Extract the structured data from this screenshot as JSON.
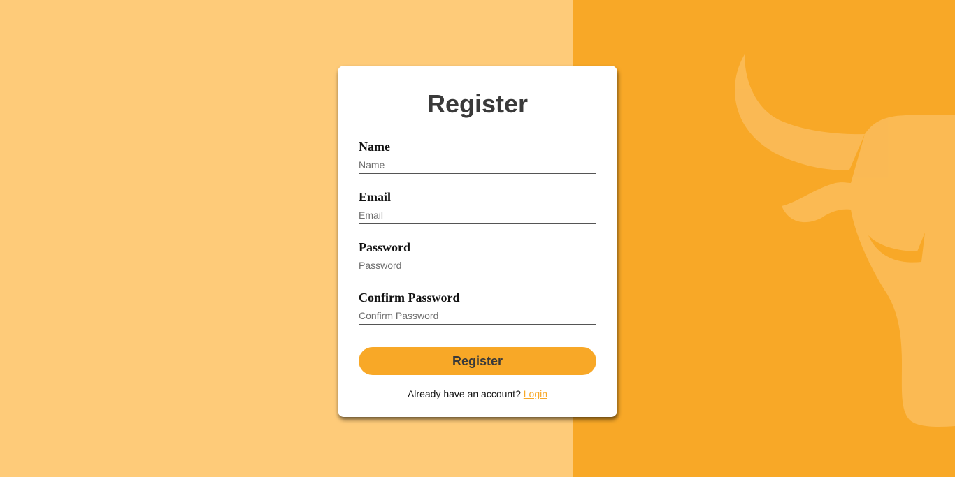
{
  "theme": {
    "left_bg": "#fecb79",
    "right_bg": "#f8a827",
    "accent": "#f8a827",
    "card_bg": "#ffffff"
  },
  "background": {
    "decoration_icon": "bull-head-icon"
  },
  "form": {
    "title": "Register",
    "fields": [
      {
        "label": "Name",
        "placeholder": "Name"
      },
      {
        "label": "Email",
        "placeholder": "Email"
      },
      {
        "label": "Password",
        "placeholder": "Password"
      },
      {
        "label": "Confirm Password",
        "placeholder": "Confirm Password"
      }
    ],
    "submit_label": "Register",
    "footer_text": "Already have an account?",
    "login_link": "Login"
  }
}
